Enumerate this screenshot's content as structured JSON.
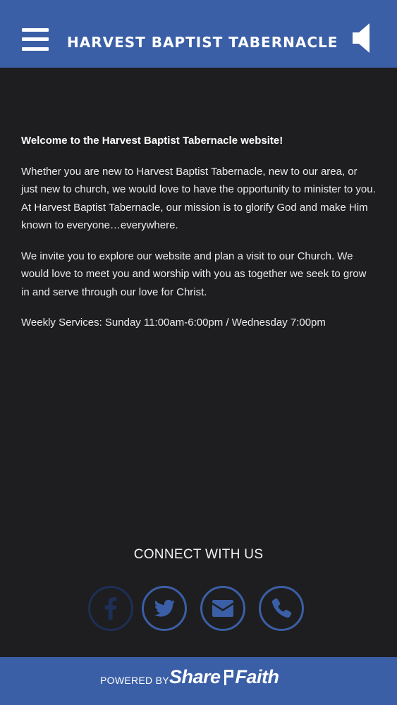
{
  "header": {
    "title": "HARVEST BAPTIST TABERNACLE",
    "menu_icon": "hamburger-menu-icon",
    "audio_icon": "speaker-icon"
  },
  "content": {
    "welcome": "Welcome to the Harvest Baptist Tabernacle website!",
    "paragraph1": "Whether you are new to Harvest Baptist Tabernacle, new to our area, or just new to church, we would love to have the opportunity to minister to you. At Harvest Baptist Tabernacle, our mission is to glorify God and make Him known to everyone…everywhere.",
    "paragraph2": "We invite you to explore our website and plan a visit to our Church. We would love to meet you and worship with you as together we seek to grow in and serve through our love for Christ.",
    "services": "Weekly Services: Sunday 11:00am-6:00pm / Wednesday 7:00pm"
  },
  "connect": {
    "title": "CONNECT WITH US",
    "links": [
      {
        "icon": "facebook-icon"
      },
      {
        "icon": "twitter-icon"
      },
      {
        "icon": "email-icon"
      },
      {
        "icon": "phone-icon"
      }
    ]
  },
  "footer": {
    "powered_by": "POWERED BY",
    "brand_part1": "Share",
    "brand_part2": "Faith"
  },
  "colors": {
    "brand_blue": "#3b5fa6",
    "background": "#1e1e20",
    "text": "#ececec",
    "facebook_dim": "#1d2f56"
  }
}
